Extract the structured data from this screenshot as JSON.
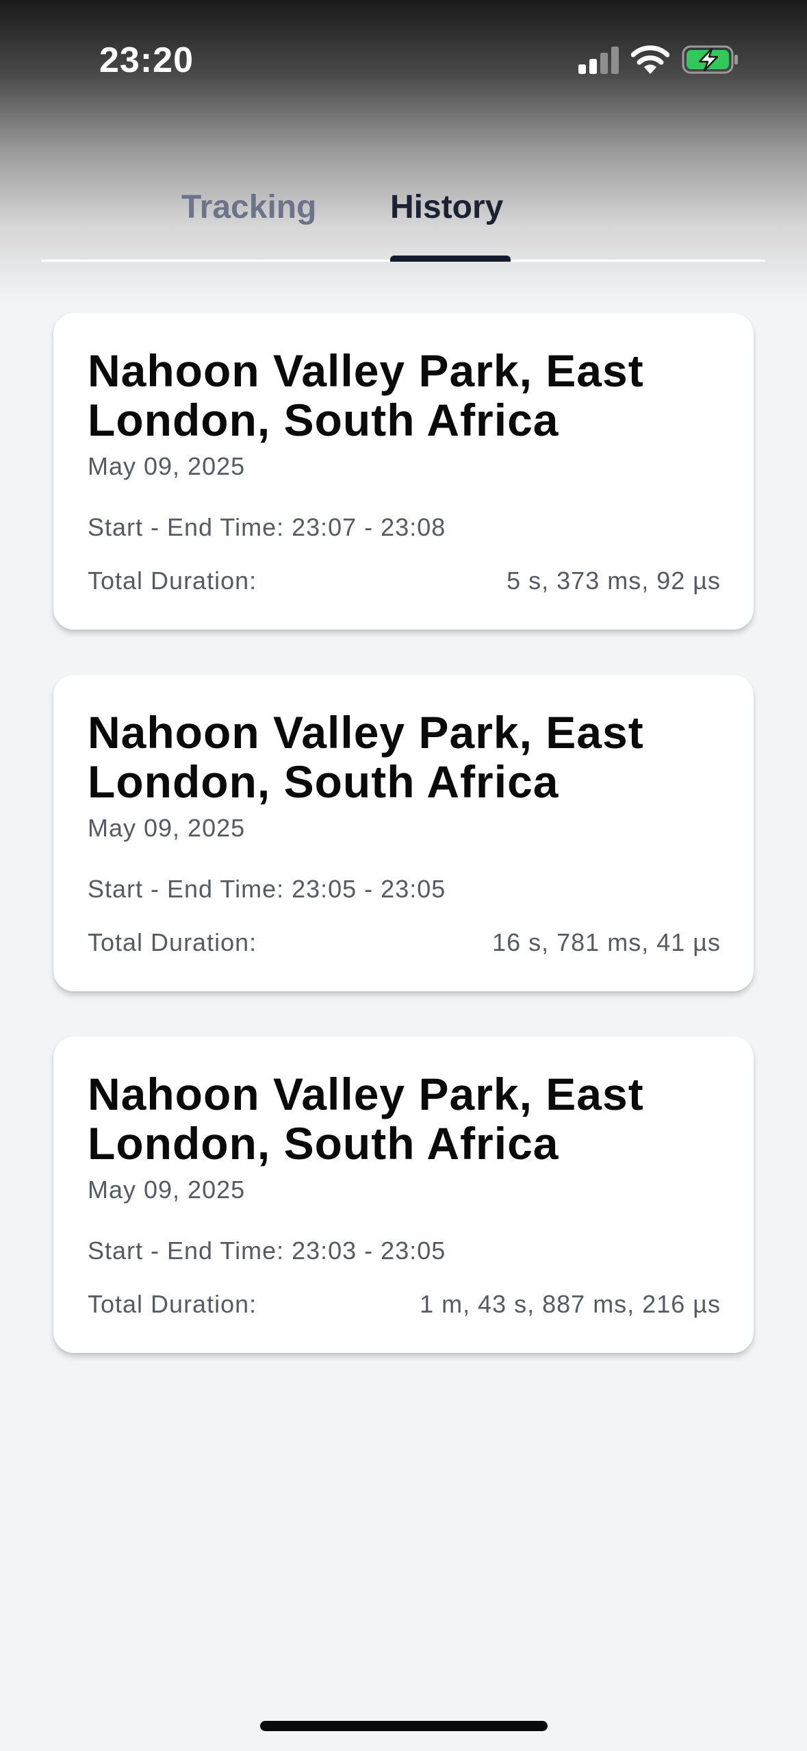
{
  "status_bar": {
    "time": "23:20",
    "signal_icon": "cellular-signal-icon",
    "wifi_icon": "wifi-icon",
    "battery_icon": "battery-charging-icon",
    "battery_color": "#34c759"
  },
  "tabs": {
    "items": [
      {
        "label": "Tracking",
        "active": false
      },
      {
        "label": "History",
        "active": true
      }
    ],
    "active_color": "#141b2c",
    "inactive_color": "#6b7489"
  },
  "history": [
    {
      "title": "Nahoon Valley Park, East London, South Africa",
      "date": "May 09, 2025",
      "time_range": "Start - End Time: 23:07 - 23:08",
      "duration_label": "Total Duration:",
      "duration_value": "5 s, 373 ms, 92 µs"
    },
    {
      "title": "Nahoon Valley Park, East London, South Africa",
      "date": "May 09, 2025",
      "time_range": "Start - End Time: 23:05 - 23:05",
      "duration_label": "Total Duration:",
      "duration_value": "16 s, 781 ms, 41 µs"
    },
    {
      "title": "Nahoon Valley Park, East London, South Africa",
      "date": "May 09, 2025",
      "time_range": "Start - End Time: 23:03 - 23:05",
      "duration_label": "Total Duration:",
      "duration_value": "1 m, 43 s, 887 ms, 216 µs"
    }
  ]
}
